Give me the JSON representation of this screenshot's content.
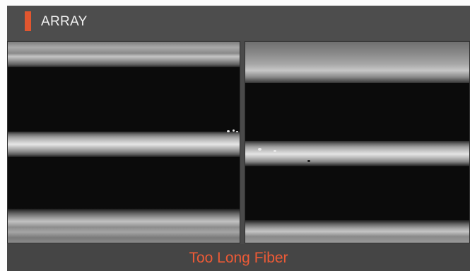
{
  "header": {
    "title": "ARRAY"
  },
  "status": {
    "message": "Too Long Fiber"
  },
  "colors": {
    "accent": "#e2562f",
    "status": "#ee5a36"
  },
  "icons": {
    "header_marker": "accent-bar"
  }
}
